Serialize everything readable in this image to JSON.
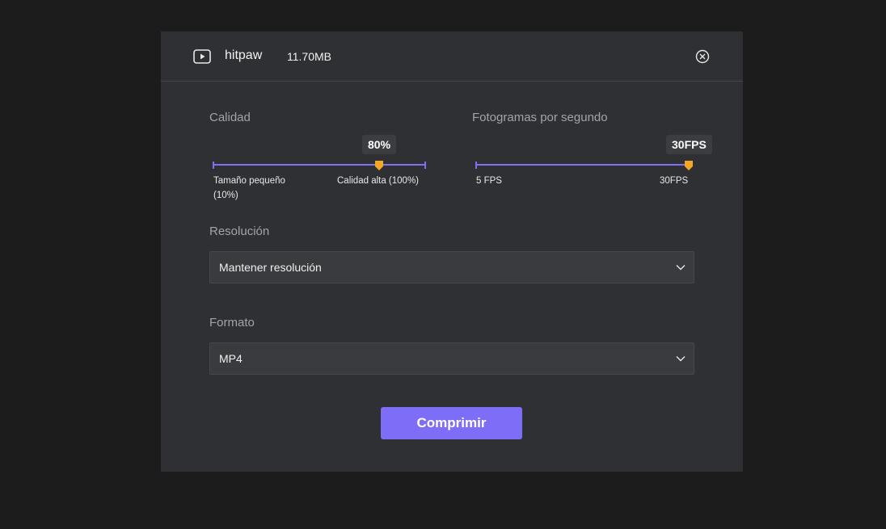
{
  "header": {
    "file_name": "hitpaw",
    "file_size": "11.70MB",
    "video_icon": "play-video-icon",
    "close_icon": "close-circle-icon"
  },
  "quality": {
    "title": "Calidad",
    "value_label": "80%",
    "value": 0.78,
    "min_label": "Tamaño pequeño\n(10%)",
    "max_label": "Calidad alta (100%)"
  },
  "fps": {
    "title": "Fotogramas por segundo",
    "value_label": "30FPS",
    "value": 1.0,
    "min_label": "5 FPS",
    "max_label": "30FPS"
  },
  "resolution": {
    "title": "Resolución",
    "selected": "Mantener resolución"
  },
  "format": {
    "title": "Formato",
    "selected": "MP4"
  },
  "actions": {
    "compress_label": "Comprimir"
  },
  "colors": {
    "accent": "#7e6ef7",
    "handle": "#f5a623",
    "annotation_arrow": "#ff2a1a",
    "dialog_bg": "#2f3033",
    "page_bg": "#1c1c1c"
  }
}
